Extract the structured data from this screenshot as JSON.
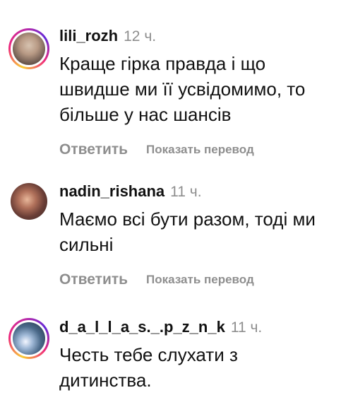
{
  "comments": [
    {
      "username": "lili_rozh",
      "time": "12 ч.",
      "text": "Краще гірка правда і що\nшвидше ми її усвідомимо, то\nбільше у нас шансів",
      "reply_label": "Ответить",
      "translate_label": "Показать перевод"
    },
    {
      "username": "nadin_rishana",
      "time": "11 ч.",
      "text": "Маємо всі бути разом, тоді ми\nсильні",
      "reply_label": "Ответить",
      "translate_label": "Показать перевод"
    },
    {
      "username": "d_a_l_l_a_s._.p_z_n_k",
      "time": "11 ч.",
      "text": "Честь тебе слухати з\nдитинства.",
      "reply_label": "",
      "translate_label": ""
    }
  ],
  "colors": {
    "text": "#111111",
    "secondary": "#8e8e8e",
    "story_ring": [
      "#f9ce34",
      "#ee2a7b",
      "#6228d7"
    ]
  }
}
